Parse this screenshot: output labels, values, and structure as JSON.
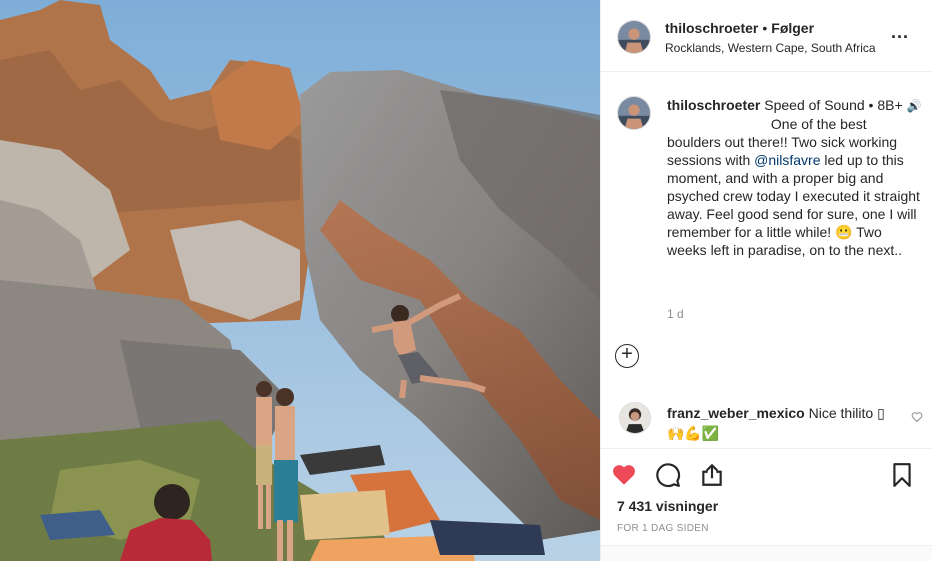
{
  "post": {
    "username": "thiloschroeter",
    "separator": "•",
    "follow_label": "Følger",
    "location": "Rocklands, Western Cape, South Africa",
    "more_label": "..."
  },
  "caption": {
    "username": "thiloschroeter",
    "title": "Speed of Sound • 8B+",
    "speaker_emoji": "🔊",
    "body_part1": "One of the best boulders out there!! Two sick working sessions with ",
    "mention": "@nilsfavre",
    "body_part2": " led up to this moment, and with a proper big and psyched crew today I executed it straight away. Feel good send for sure, one I will remember for a little while! ",
    "grin_emoji": "😬",
    "body_part3": " Two weeks left in paradise, on to the next..",
    "time_ago": "1 d"
  },
  "add_comment_symbol": "+",
  "comment": {
    "username": "franz_weber_mexico",
    "text": "Nice thilito",
    "emojis": "▯🙌💪✅"
  },
  "stats": {
    "views": "7 431 visninger",
    "posted": "FOR 1 DAG SIDEN"
  },
  "icons": {
    "like": "heart-filled-icon",
    "comment": "speech-bubble-icon",
    "share": "share-icon",
    "save": "bookmark-icon",
    "comment_like": "heart-outline-icon"
  },
  "colors": {
    "like_red": "#ed4956",
    "mention_blue": "#00376b",
    "meta_gray": "#8e8e8e"
  }
}
